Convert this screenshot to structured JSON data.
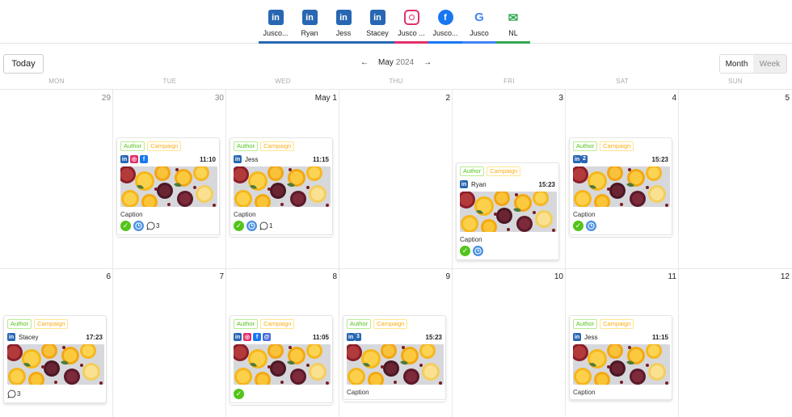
{
  "channels": [
    {
      "label": "Jusco...",
      "icon": "linkedin-icon",
      "glyph": "in",
      "color": "#2867b2"
    },
    {
      "label": "Ryan",
      "icon": "linkedin-icon",
      "glyph": "in",
      "color": "#2867b2"
    },
    {
      "label": "Jess",
      "icon": "linkedin-icon",
      "glyph": "in",
      "color": "#2867b2"
    },
    {
      "label": "Stacey",
      "icon": "linkedin-icon",
      "glyph": "in",
      "color": "#2867b2"
    },
    {
      "label": "Jusco ...",
      "icon": "instagram-icon",
      "glyph": "◎",
      "color": "#e1306c"
    },
    {
      "label": "Jusco...",
      "icon": "facebook-icon",
      "glyph": "f",
      "color": "#1877f2"
    },
    {
      "label": "Jusco",
      "icon": "google-icon",
      "glyph": "G",
      "color": "#4285f4"
    },
    {
      "label": "NL",
      "icon": "mail-icon",
      "glyph": "✉",
      "color": "#34a853"
    }
  ],
  "toolbar": {
    "today": "Today",
    "month": "May",
    "year": "2024",
    "view_month": "Month",
    "view_week": "Week"
  },
  "weekdays": [
    "MON",
    "TUE",
    "WED",
    "THU",
    "FRI",
    "SAT",
    "SUN"
  ],
  "week1_days": [
    "29",
    "30",
    "May 1",
    "2",
    "3",
    "4",
    "5"
  ],
  "week2_days": [
    "6",
    "7",
    "8",
    "9",
    "10",
    "11",
    "12"
  ],
  "posts": {
    "tue30": {
      "author": "Author",
      "campaign": "Campaign",
      "time": "11:10",
      "caption": "Caption",
      "comments": "3"
    },
    "wed1": {
      "author": "Author",
      "campaign": "Campaign",
      "name": "Jess",
      "time": "11:15",
      "caption": "Caption",
      "comments": "1"
    },
    "fri3": {
      "author": "Author",
      "campaign": "Campaign",
      "name": "Ryan",
      "time": "15:23",
      "caption": "Caption"
    },
    "sat4": {
      "author": "Author",
      "campaign": "Campaign",
      "count": "2",
      "time": "15:23",
      "caption": "Caption"
    },
    "mon6": {
      "author": "Author",
      "campaign": "Campaign",
      "name": "Stacey",
      "time": "17:23",
      "comments": "3"
    },
    "wed8": {
      "author": "Author",
      "campaign": "Campaign",
      "time": "11:05"
    },
    "thu9": {
      "author": "Author",
      "campaign": "Campaign",
      "count": "3",
      "time": "15:23",
      "caption": "Caption"
    },
    "sat11": {
      "author": "Author",
      "campaign": "Campaign",
      "name": "Jess",
      "time": "11:15",
      "caption": "Caption"
    }
  }
}
